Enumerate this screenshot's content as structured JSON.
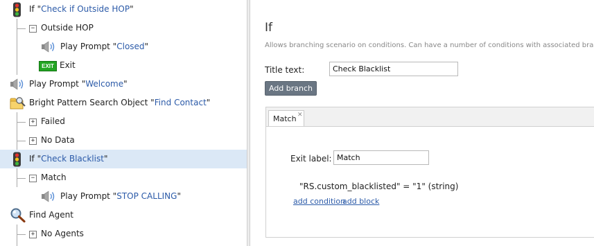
{
  "tree": {
    "rows": [
      {
        "pre": "If \"",
        "name": "Check if Outside HOP",
        "post": "\""
      },
      {
        "label": "Outside HOP"
      },
      {
        "pre": "Play Prompt \"",
        "name": "Closed",
        "post": "\""
      },
      {
        "label": "Exit",
        "badge": "EXIT"
      },
      {
        "pre": "Play Prompt \"",
        "name": "Welcome",
        "post": "\""
      },
      {
        "pre": "Bright Pattern Search Object \"",
        "name": "Find Contact",
        "post": "\""
      },
      {
        "label": "Failed"
      },
      {
        "label": "No Data"
      },
      {
        "pre": "If \"",
        "name": "Check Blacklist",
        "post": "\""
      },
      {
        "label": "Match"
      },
      {
        "pre": "Play Prompt \"",
        "name": "STOP CALLING",
        "post": "\""
      },
      {
        "label": "Find Agent"
      },
      {
        "label": "No Agents"
      }
    ],
    "expander_collapsed": "+",
    "expander_expanded": "−"
  },
  "panel": {
    "title": "If",
    "description": "Allows branching scenario on conditions. Can have a number of conditions with associated branches.",
    "title_text_label": "Title text:",
    "title_text_value": "Check Blacklist",
    "add_branch_label": "Add branch",
    "tab": {
      "label": "Match",
      "close": "✕"
    },
    "exit_label_label": "Exit label:",
    "exit_label_value": "Match",
    "condition": "\"RS.custom_blacklisted\" = \"1\" (string)",
    "add_condition": "add condition",
    "add_block": "add block"
  },
  "colors": {
    "selected_row": "#dbe8f6",
    "link": "#2b5aa8",
    "branch": "#3e7d17",
    "button": "#6a7683"
  }
}
